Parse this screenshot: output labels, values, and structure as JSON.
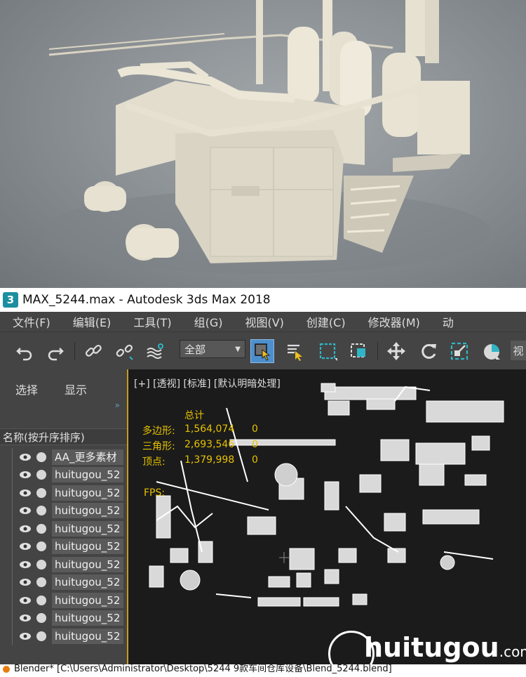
{
  "window": {
    "title": "MAX_5244.max - Autodesk 3ds Max 2018",
    "app_icon": "3"
  },
  "menu": [
    "文件(F)",
    "编辑(E)",
    "工具(T)",
    "组(G)",
    "视图(V)",
    "创建(C)",
    "修改器(M)",
    "动"
  ],
  "toolbar": {
    "selection_filter": "全部",
    "view_label": "视"
  },
  "left_panel": {
    "tabs": [
      "选择",
      "显示"
    ],
    "column_header": "名称(按升序排序)",
    "items": [
      "AA_更多素材",
      "huitugou_52",
      "huitugou_52",
      "huitugou_52",
      "huitugou_52",
      "huitugou_52",
      "huitugou_52",
      "huitugou_52",
      "huitugou_52",
      "huitugou_52",
      "huitugou_52"
    ]
  },
  "viewport": {
    "label": "[+] [透视] [标准] [默认明暗处理]",
    "stats": {
      "total_label": "总计",
      "rows": [
        {
          "label": "多边形:",
          "value": "1,564,074",
          "extra": "0"
        },
        {
          "label": "三角形:",
          "value": "2,693,546",
          "extra": "0"
        },
        {
          "label": "顶点:",
          "value": "1,379,998",
          "extra": "0"
        }
      ],
      "fps_label": "FPS:"
    }
  },
  "status_bar": "Blender* [C:\\Users\\Administrator\\Desktop\\5244 9款车间仓库设备\\Blend_5244.blend]",
  "watermark": {
    "main": "huitugou",
    "suffix": ".com"
  },
  "colors": {
    "accent": "#c69b23",
    "stats": "#e6c200",
    "toolbar_active": "#4d8fcc",
    "teal_icon": "#2fb5c6"
  }
}
